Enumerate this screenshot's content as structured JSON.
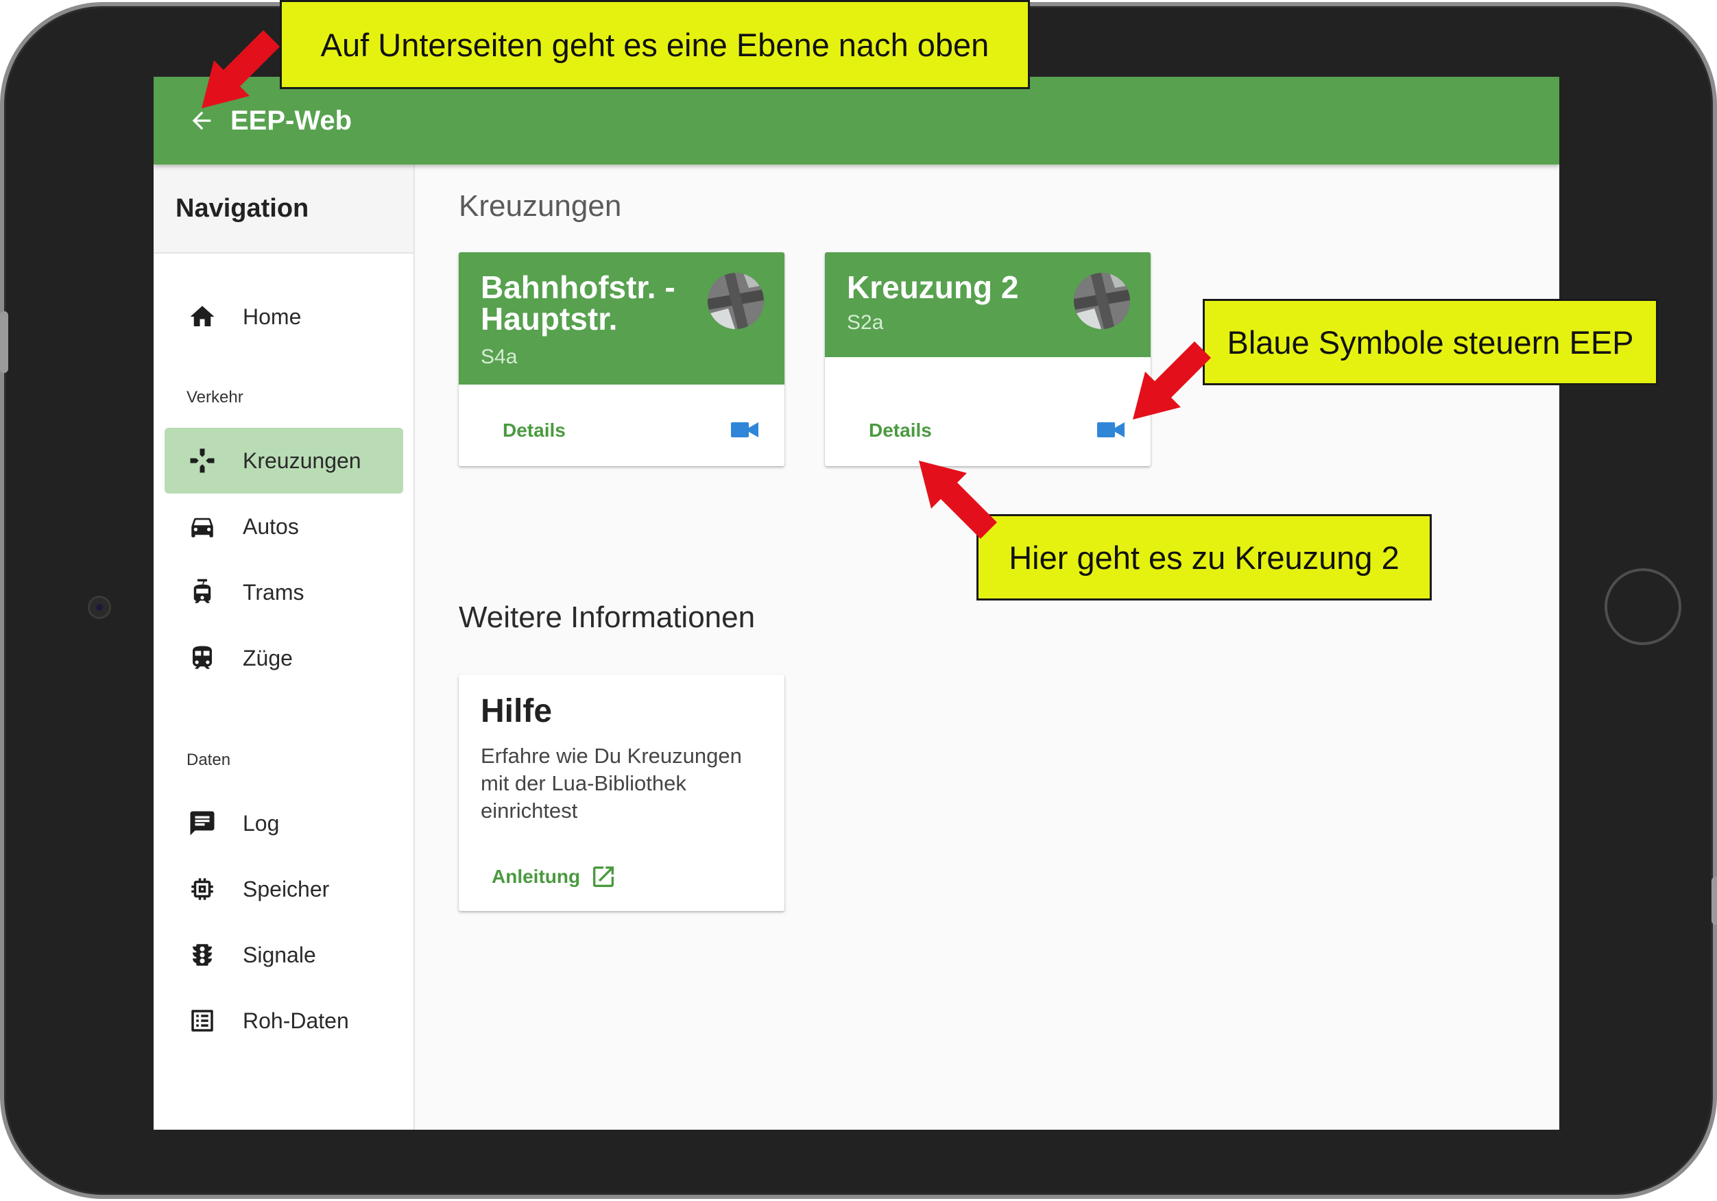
{
  "appbar": {
    "title": "EEP-Web",
    "back_icon": "arrow-left-icon",
    "color": "#57a14f"
  },
  "sidebar": {
    "header": "Navigation",
    "items": [
      {
        "label": "Home",
        "icon": "home-icon"
      },
      {
        "label": "Kreuzungen",
        "icon": "crossing-icon",
        "active": true
      },
      {
        "label": "Autos",
        "icon": "car-icon"
      },
      {
        "label": "Trams",
        "icon": "tram-icon"
      },
      {
        "label": "Züge",
        "icon": "train-icon"
      },
      {
        "label": "Log",
        "icon": "message-icon"
      },
      {
        "label": "Speicher",
        "icon": "memory-chip-icon"
      },
      {
        "label": "Signale",
        "icon": "traffic-light-icon"
      },
      {
        "label": "Roh-Daten",
        "icon": "list-icon"
      }
    ],
    "sections": {
      "traffic": "Verkehr",
      "data": "Daten"
    }
  },
  "main": {
    "crossings_title": "Kreuzungen",
    "crossings": [
      {
        "title": "Bahnhofstr. - Hauptstr.",
        "subtitle": "S4a",
        "action": "Details",
        "camera_icon": "video-camera-icon"
      },
      {
        "title": "Kreuzung 2",
        "subtitle": "S2a",
        "action": "Details",
        "camera_icon": "video-camera-icon"
      }
    ],
    "more_title": "Weitere Informationen",
    "help": {
      "title": "Hilfe",
      "text": "Erfahre wie Du Kreuzungen mit der Lua-Bibliothek einrichtest",
      "link": "Anleitung",
      "link_icon": "open-in-new-icon"
    }
  },
  "callouts": {
    "top": "Auf Unterseiten geht es eine Ebene nach oben",
    "right": "Blaue Symbole steuern EEP",
    "bottom": "Hier geht es zu Kreuzung 2"
  },
  "colors": {
    "accent_green": "#57a14f",
    "active_nav": "#b9dcb5",
    "icon_blue": "#2f86d8",
    "callout_yellow": "#e5f210",
    "arrow_red": "#e3101b"
  }
}
